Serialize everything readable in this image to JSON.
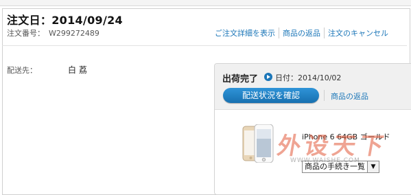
{
  "order": {
    "date_label": "注文日：",
    "date_value": "2014/09/24",
    "number_label": "注文番号：",
    "number_value": "W299272489",
    "actions": [
      "ご注文詳細を表示",
      "商品の返品",
      "注文のキャンセル"
    ]
  },
  "shipping": {
    "label": "配送先：",
    "name": "白 荔"
  },
  "shipment": {
    "status": "出荷完了",
    "date_text": "日付：2014/10/02",
    "track_button": "配送状況を確認",
    "return_link": "商品の返品"
  },
  "product": {
    "name": "iPhone 6 64GB ゴールド",
    "select_value": "商品の手続き一覧",
    "image_icon": "iphone-thumbnail"
  },
  "watermark": {
    "text": "外设天下",
    "sub": "WWW.WAISHE.COM"
  },
  "colors": {
    "link": "#1b76b8",
    "button": "#1f7fc4",
    "header_bg": "#f0f0f0"
  }
}
